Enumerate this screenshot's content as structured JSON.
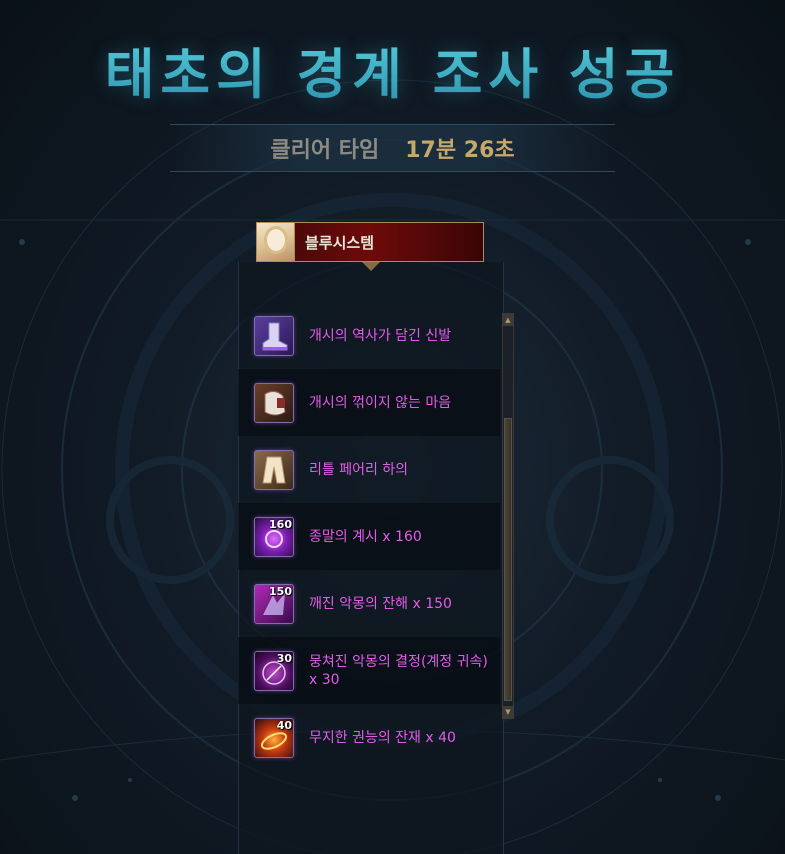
{
  "title": "태초의 경계 조사 성공",
  "clear": {
    "label": "클리어 타임",
    "time": "17분 26초"
  },
  "player": {
    "name": "블루시스템"
  },
  "items": [
    {
      "name": "개시의 역사가 담긴 신발",
      "qty": "",
      "icon": "shoes-icon"
    },
    {
      "name": "개시의 꺾이지 않는 마음",
      "qty": "",
      "icon": "heart-relic-icon"
    },
    {
      "name": "리틀 페어리 하의",
      "qty": "",
      "icon": "fairy-pants-icon"
    },
    {
      "name": "종말의 계시 x 160",
      "qty": "160",
      "icon": "purple-orb-icon"
    },
    {
      "name": "깨진 악몽의 잔해 x 150",
      "qty": "150",
      "icon": "nightmare-shard-icon"
    },
    {
      "name": "뭉쳐진 악몽의 결정(계정 귀속) x 30",
      "qty": "30",
      "icon": "nightmare-crystal-icon"
    },
    {
      "name": "무지한 권능의 잔재 x 40",
      "qty": "40",
      "icon": "fire-ring-icon"
    }
  ]
}
